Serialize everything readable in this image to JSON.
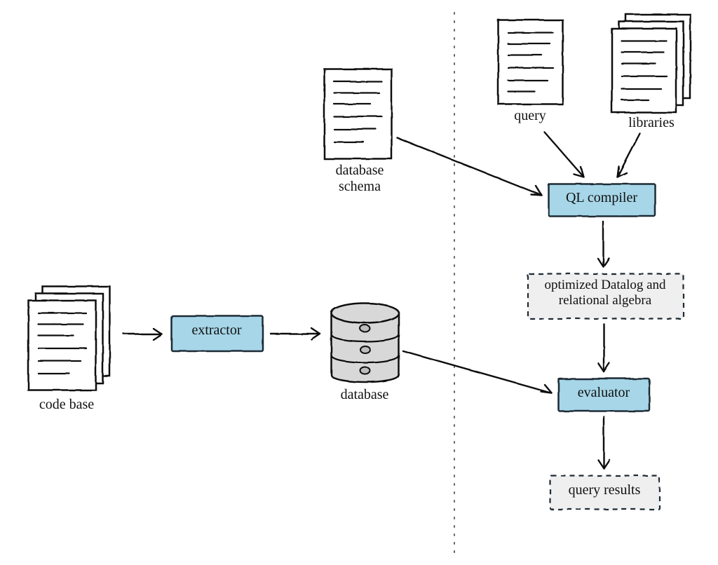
{
  "nodes": {
    "code_base": {
      "label": "code base"
    },
    "extractor": {
      "label": "extractor"
    },
    "database": {
      "label": "database"
    },
    "database_schema": {
      "label": "database\nschema"
    },
    "query": {
      "label": "query"
    },
    "libraries": {
      "label": "libraries"
    },
    "ql_compiler": {
      "label": "QL compiler"
    },
    "optimized": {
      "label": "optimized Datalog and\nrelational algebra"
    },
    "evaluator": {
      "label": "evaluator"
    },
    "query_results": {
      "label": "query results"
    }
  },
  "colors": {
    "box_fill": "#a6d6e8",
    "box_stroke": "#1f2a36",
    "dashed_fill": "#efefef",
    "db_fill": "#d8d8d8",
    "stroke": "#1b1b1b"
  },
  "edges": [
    "code_base -> extractor",
    "extractor -> database",
    "database -> evaluator",
    "database_schema -> ql_compiler",
    "query -> ql_compiler",
    "libraries -> ql_compiler",
    "ql_compiler -> optimized",
    "optimized -> evaluator",
    "evaluator -> query_results"
  ]
}
